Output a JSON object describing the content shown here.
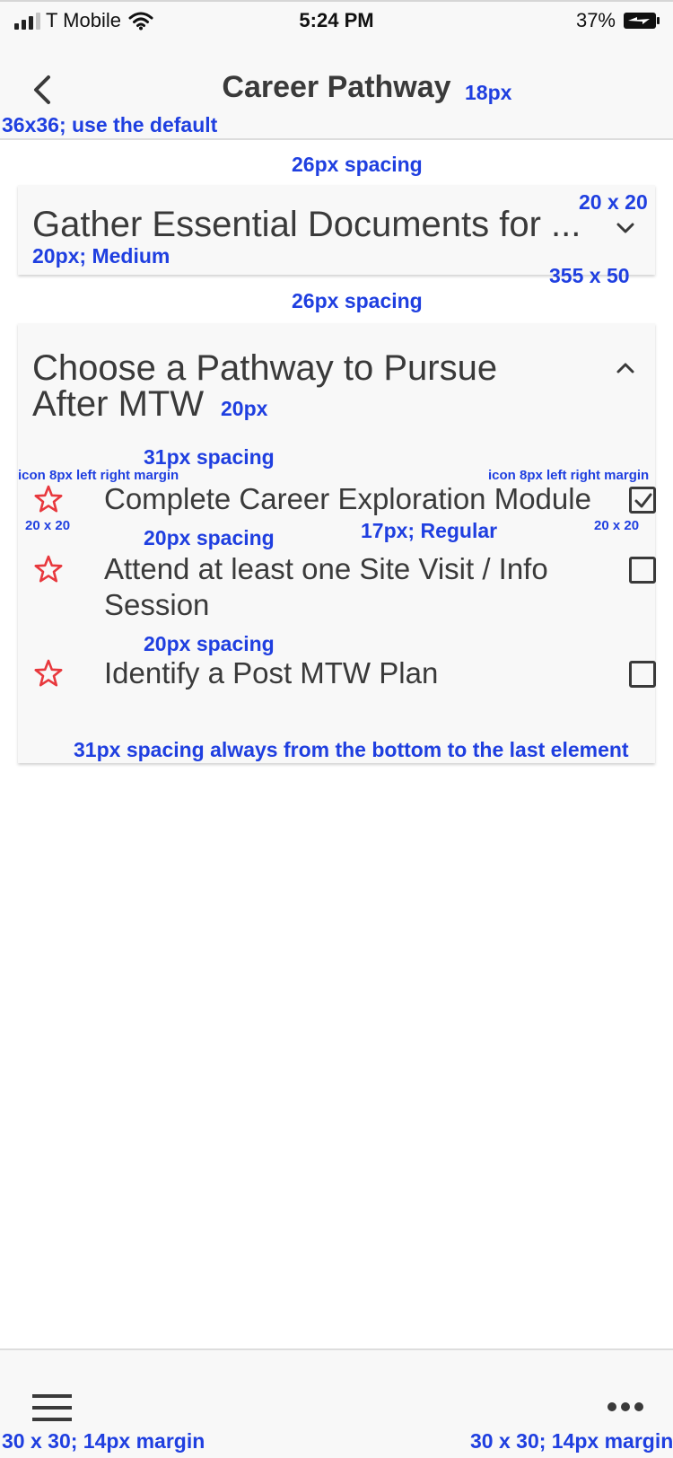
{
  "status_bar": {
    "carrier": "T Mobile",
    "time": "5:24 PM",
    "battery": "37%"
  },
  "nav": {
    "title": "Career Pathway",
    "back_icon": "chevron-left-icon"
  },
  "cards": [
    {
      "title": "Gather Essential Documents for ...",
      "expanded": false,
      "chevron_icon": "chevron-down-icon"
    },
    {
      "title_line1": "Choose a Pathway to Pursue",
      "title_line2": "After MTW",
      "expanded": true,
      "chevron_icon": "chevron-up-icon",
      "tasks": [
        {
          "label": "Complete Career Exploration Module",
          "checked": true,
          "icon": "star-outline-icon"
        },
        {
          "label": "Attend at least one Site Visit / Info Session",
          "checked": false,
          "icon": "star-outline-icon"
        },
        {
          "label": "Identify a Post MTW Plan",
          "checked": false,
          "icon": "star-outline-icon"
        }
      ]
    }
  ],
  "annotations": {
    "nav_font": "18px",
    "back_size": "36x36; use the default",
    "spacing_top": "26px spacing",
    "chevron_size": "20 x 20",
    "card1_font": "20px; Medium",
    "card1_size": "355 x 50",
    "spacing_between": "26px spacing",
    "card2_font": "20px",
    "spacing_31": "31px spacing",
    "icon_margin_left": "icon 8px left right margin",
    "icon_margin_right": "icon 8px left right margin",
    "star_size": "20 x 20",
    "check_size": "20 x 20",
    "spacing_20_a": "20px spacing",
    "task_font": "17px; Regular",
    "spacing_20_b": "20px spacing",
    "bottom_spacing": "31px spacing always from the bottom to the last element",
    "tab_left": "30 x 30; 14px margin",
    "tab_right": "30 x 30; 14px margin"
  },
  "tab_bar": {
    "left_icon": "menu-icon",
    "right_icon": "more-icon"
  },
  "colors": {
    "annotation": "#1f3fe0",
    "star": "#e8383d",
    "text": "#3a3a3a",
    "bar_bg": "#f8f8f8"
  }
}
